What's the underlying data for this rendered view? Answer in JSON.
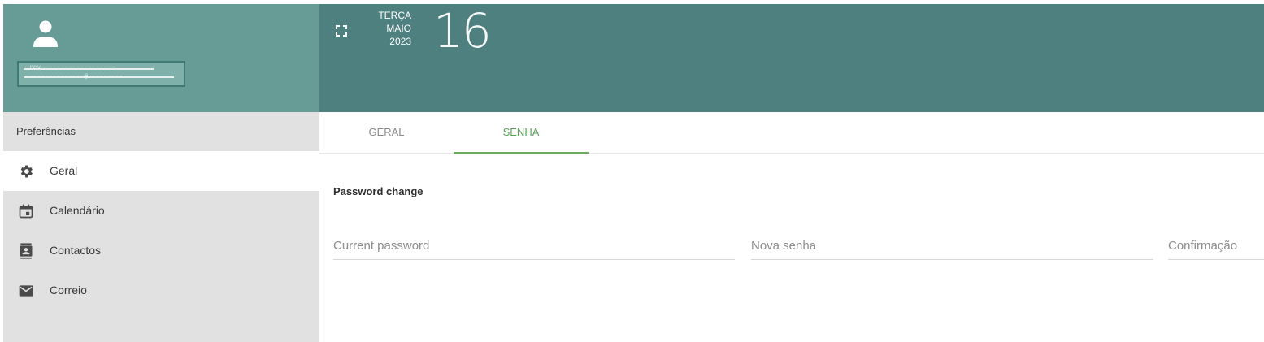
{
  "profile": {
    "identity_line1": "~rev~~~~~~~~~~~~~~~~~~~",
    "identity_line2": "~~~~~~~~~~~~~~~@~~~~~~~~~"
  },
  "header": {
    "weekday": "TERÇA",
    "month": "MAIO",
    "year": "2023",
    "day": "16"
  },
  "sidebar": {
    "title": "Preferências",
    "items": [
      {
        "label": "Geral",
        "icon": "gear-icon",
        "active": true
      },
      {
        "label": "Calendário",
        "icon": "calendar-icon",
        "active": false
      },
      {
        "label": "Contactos",
        "icon": "contacts-icon",
        "active": false
      },
      {
        "label": "Correio",
        "icon": "mail-icon",
        "active": false
      }
    ]
  },
  "tabs": [
    {
      "label": "GERAL",
      "active": false
    },
    {
      "label": "SENHA",
      "active": true
    }
  ],
  "main": {
    "section_title": "Password change",
    "fields": {
      "current_placeholder": "Current password",
      "new_placeholder": "Nova senha",
      "confirm_placeholder": "Confirmação"
    }
  },
  "colors": {
    "profile_bg": "#669b96",
    "header_bg": "#4f8080",
    "sidebar_bg": "#e1e1e1",
    "active_tab": "#5aa25a"
  }
}
